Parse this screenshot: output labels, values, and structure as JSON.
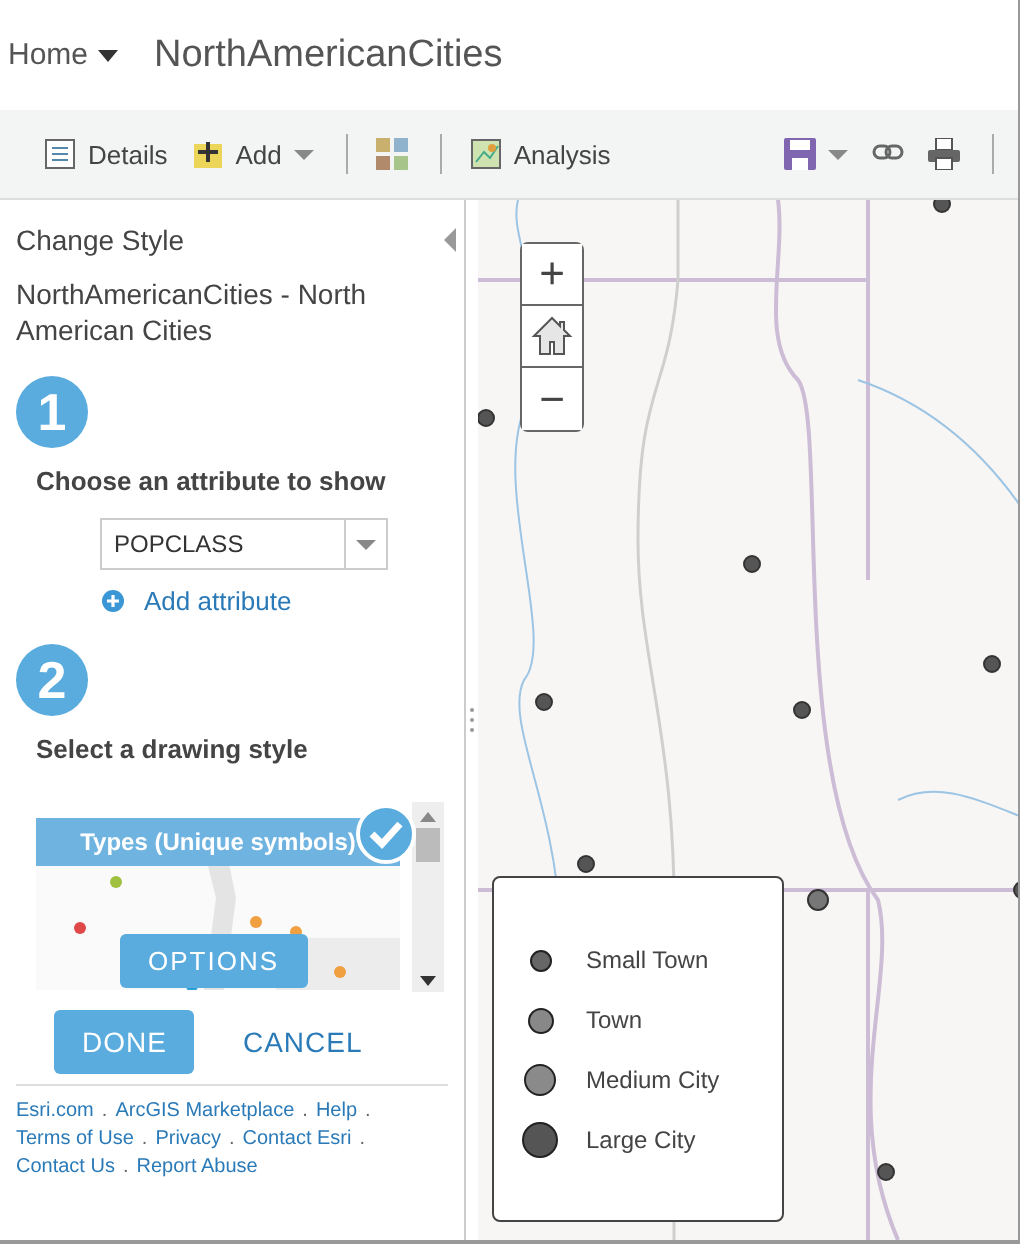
{
  "header": {
    "home": "Home",
    "title": "NorthAmericanCities"
  },
  "toolbar": [
    {
      "kind": "details",
      "label": "Details"
    },
    {
      "kind": "add",
      "label": "Add",
      "dropdown": true
    },
    {
      "kind": "separator"
    },
    {
      "kind": "basemap"
    },
    {
      "kind": "separator"
    },
    {
      "kind": "analysis",
      "label": "Analysis"
    },
    {
      "kind": "spacer"
    },
    {
      "kind": "save",
      "dropdown": true
    },
    {
      "kind": "share"
    },
    {
      "kind": "print"
    },
    {
      "kind": "separator"
    }
  ],
  "panel": {
    "heading": "Change Style",
    "layer": "NorthAmericanCities - North American Cities",
    "steps": [
      {
        "number": "1",
        "label": "Choose an attribute to show"
      },
      {
        "number": "2",
        "label": "Select a drawing style"
      }
    ],
    "attribute": {
      "value": "POPCLASS"
    },
    "add_attribute": "Add attribute",
    "style_card": {
      "title": "Types (Unique symbols)",
      "selected": true,
      "button": "OPTIONS"
    },
    "buttons": [
      {
        "kind": "primary",
        "label": "DONE"
      },
      {
        "kind": "link",
        "label": "CANCEL"
      }
    ],
    "footer_separator": ".",
    "footer_links": [
      "Esri.com",
      "ArcGIS Marketplace",
      "Help",
      "Terms of Use",
      "Privacy",
      "Contact Esri",
      "Contact Us",
      "Report Abuse"
    ]
  },
  "map": {
    "zoom_in": "+",
    "zoom_out": "−",
    "legend": [
      {
        "label": "Small Town",
        "kind": "xs",
        "color": "#666666"
      },
      {
        "label": "Town",
        "kind": "s",
        "color": "#888888"
      },
      {
        "label": "Medium City",
        "kind": "m",
        "color": "#8a8a8a"
      },
      {
        "label": "Large City",
        "kind": "l",
        "color": "#555555"
      }
    ]
  }
}
